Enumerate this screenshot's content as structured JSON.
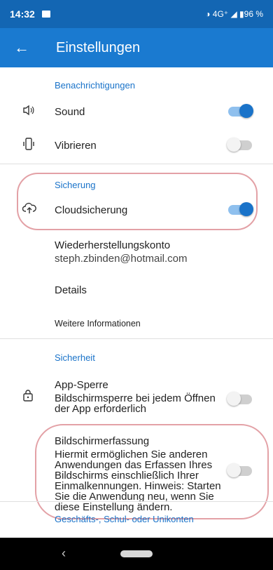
{
  "status": {
    "time": "14:32",
    "right": "◑ 4G⁺ ◢ ▮96 %"
  },
  "appbar": {
    "title": "Einstellungen",
    "back_icon": "←"
  },
  "sections": {
    "benachrichtigungen": "Benachrichtigungen",
    "sicherung": "Sicherung",
    "sicherheit": "Sicherheit",
    "next": "Geschäfts-, Schul- oder Unikonten"
  },
  "rows": {
    "sound": "Sound",
    "vibrieren": "Vibrieren",
    "cloud": "Cloudsicherung",
    "wiederherstellungskonto": "Wiederherstellungskonto",
    "email": "steph.zbinden@hotmail.com",
    "details": "Details",
    "weitere": "Weitere Informationen",
    "app_sperre": "App-Sperre",
    "app_sperre_desc": "Bildschirmsperre bei jedem Öffnen der App erforderlich",
    "bildschirmerfassung": "Bildschirmerfassung",
    "bildschirmerfassung_desc": "Hiermit ermöglichen Sie anderen Anwendungen das Erfassen Ihres Bildschirms einschließlich Ihrer Einmalkennungen. Hinweis: Starten Sie die Anwendung neu, wenn Sie diese Einstellung ändern."
  },
  "toggles": {
    "sound": true,
    "vibrieren": false,
    "cloud": true,
    "app_sperre": false,
    "bildschirmerfassung": false
  },
  "colors": {
    "accent": "#1a73c9",
    "appbar": "#1a7ad0",
    "statusbar": "#1366b3",
    "annotation": "#e3a1a6"
  },
  "icons": {
    "sound": "speaker-icon",
    "vibrieren": "vibrate-icon",
    "cloud": "cloud-upload-icon",
    "lock": "lock-icon"
  }
}
